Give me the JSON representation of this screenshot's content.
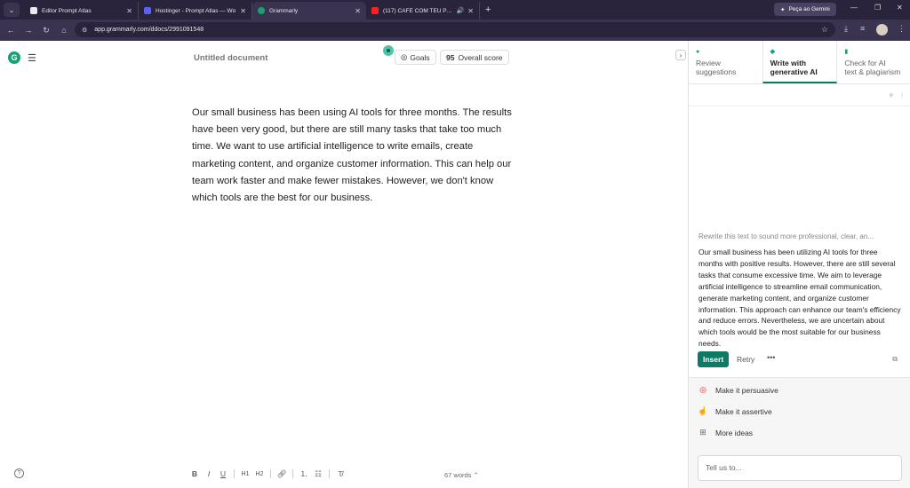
{
  "browser": {
    "tabs": [
      {
        "title": "Editor Prompt Atlas",
        "favicon_color": "#e9e9ee",
        "active": false
      },
      {
        "title": "Hostinger - Prompt Atlas — Wo",
        "favicon_color": "#5a63f0",
        "active": false
      },
      {
        "title": "Grammarly",
        "favicon_color": "#15a36e",
        "active": true
      },
      {
        "title": "(117) CAFÉ COM TEU PAI s",
        "favicon_color": "#ff1f1f",
        "active": false
      }
    ],
    "gemini_label": "Peça ao Gemini",
    "url": "app.grammarly.com/ddocs/2991091548"
  },
  "editor": {
    "doc_title": "Untitled document",
    "goals_label": "Goals",
    "score_value": "95",
    "score_label": "Overall score",
    "body_text": "Our small business has been using AI tools for three months. The results have been very good, but there are still many tasks that take too much time. We want to use artificial intelligence to write emails, create marketing content, and organize customer information. This can help our team work faster and make fewer mistakes. However, we don't know which tools are the best for our business.",
    "word_count": "67 words",
    "format_buttons": [
      "B",
      "I",
      "U",
      "H1",
      "H2",
      "link",
      "ordered-list",
      "bulleted-list",
      "clear-format"
    ]
  },
  "panel": {
    "tabs": [
      {
        "line1": "Review",
        "line2": "suggestions",
        "active": false
      },
      {
        "line1": "Write with",
        "line2": "generative AI",
        "active": true
      },
      {
        "line1": "Check for AI",
        "line2": "text & plagiarism",
        "active": false
      }
    ],
    "prompt_label": "Rewrite this text to sound more professional, clear, an...",
    "rewrite_text": "Our small business has been utilizing AI tools for three months with positive results. However, there are still several tasks that consume excessive time. We aim to leverage artificial intelligence to streamline email communication, generate marketing content, and organize customer information. This approach can enhance our team's efficiency and reduce errors. Nevertheless, we are uncertain about which tools would be the most suitable for our business needs.",
    "insert_label": "Insert",
    "retry_label": "Retry",
    "ideas": [
      {
        "label": "Make it persuasive",
        "icon": "target-icon"
      },
      {
        "label": "Make it assertive",
        "icon": "pointing-hand-icon"
      },
      {
        "label": "More ideas",
        "icon": "grid-plus-icon"
      }
    ],
    "chat_placeholder": "Tell us to..."
  },
  "colors": {
    "brand_green": "#15a36e",
    "accent_teal": "#0d7a66",
    "chrome_dark": "#29233b"
  }
}
